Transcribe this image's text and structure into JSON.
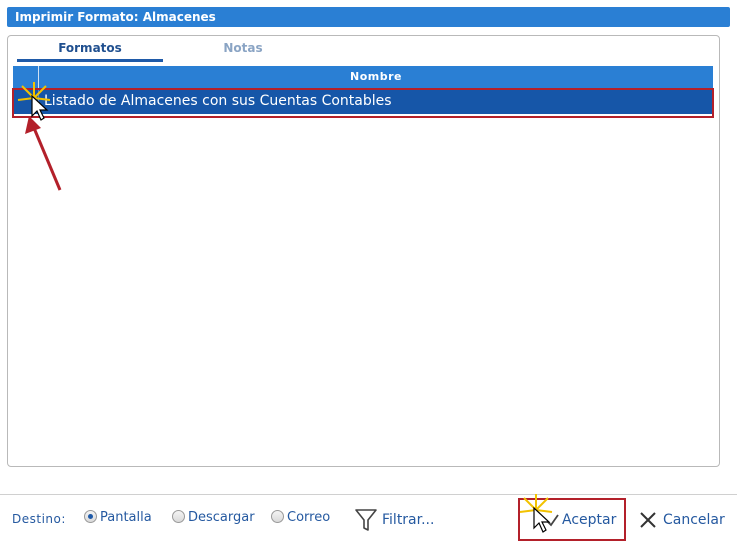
{
  "window": {
    "title": "Imprimir Formato: Almacenes"
  },
  "tabs": [
    {
      "label": "Formatos",
      "active": true
    },
    {
      "label": "Notas",
      "active": false
    }
  ],
  "grid": {
    "columns": [
      "Nombre"
    ],
    "rows": [
      {
        "nombre": "Listado de Almacenes con sus Cuentas Contables",
        "selected": true
      }
    ]
  },
  "footer": {
    "destino_label": "Destino:",
    "destinos": [
      {
        "label": "Pantalla",
        "checked": true
      },
      {
        "label": "Descargar",
        "checked": false
      },
      {
        "label": "Correo",
        "checked": false
      }
    ],
    "filtrar_label": "Filtrar...",
    "aceptar_label": "Aceptar",
    "cancelar_label": "Cancelar"
  },
  "colors": {
    "titlebar": "#2a7fd4",
    "selected_row": "#1656a8",
    "annotation_red": "#b3202a",
    "text_blue": "#2559a0"
  }
}
